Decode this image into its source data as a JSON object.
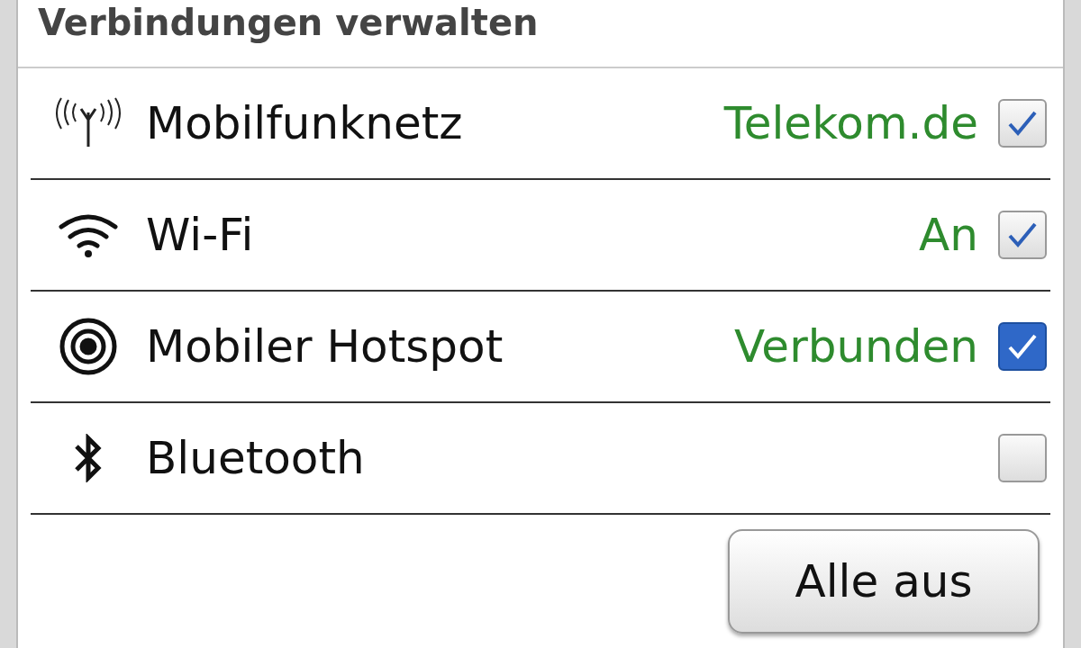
{
  "title": "Verbindungen verwalten",
  "connections": [
    {
      "kind": "cellular",
      "name": "Mobilfunknetz",
      "status": "Telekom.de",
      "checked": true,
      "focused": false
    },
    {
      "kind": "wifi",
      "name": "Wi-Fi",
      "status": "An",
      "checked": true,
      "focused": false
    },
    {
      "kind": "hotspot",
      "name": "Mobiler Hotspot",
      "status": "Verbunden",
      "checked": true,
      "focused": true
    },
    {
      "kind": "bluetooth",
      "name": "Bluetooth",
      "checked": false,
      "focused": false
    }
  ],
  "button": "Alle aus"
}
